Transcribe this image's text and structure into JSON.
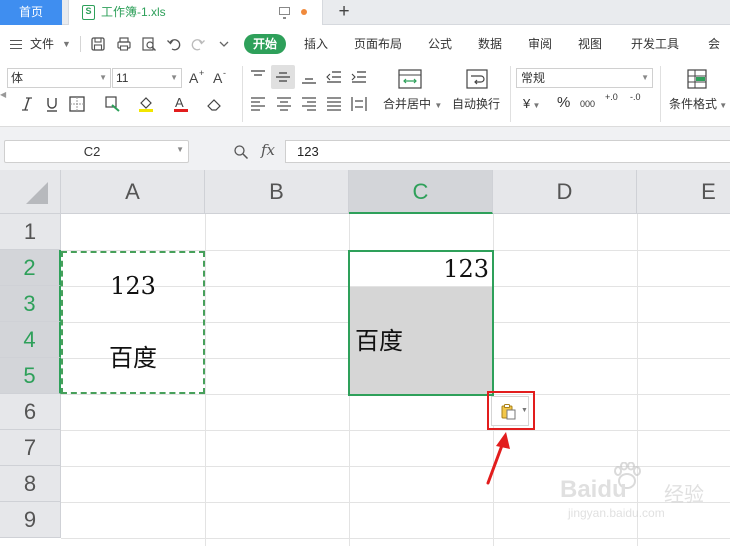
{
  "tabs": {
    "home": "首页",
    "document": "工作簿-1.xls",
    "document_icon": "S",
    "add": "+"
  },
  "menu": {
    "file": "文件",
    "tabs": [
      "开始",
      "插入",
      "页面布局",
      "公式",
      "数据",
      "审阅",
      "视图",
      "开发工具",
      "会员"
    ],
    "active_tab": "开始"
  },
  "toolbar": {
    "font_name": "体",
    "font_size": "11",
    "merge_center": "合并居中",
    "wrap_text": "自动换行",
    "number_format": "常规",
    "currency": "¥",
    "percent": "%",
    "thousands": "000",
    "dec_increase": "+.0",
    "dec_decrease": "-.0",
    "conditional_format": "条件格式"
  },
  "formula_bar": {
    "name_box": "C2",
    "fx": "fx",
    "content": "123"
  },
  "sheet": {
    "columns": [
      "A",
      "B",
      "C",
      "D",
      "E"
    ],
    "selected_column": "C",
    "rows": [
      "1",
      "2",
      "3",
      "4",
      "5",
      "6",
      "7",
      "8",
      "9"
    ],
    "selected_rows": [
      "2",
      "3",
      "4",
      "5"
    ],
    "cells": {
      "A2_3": "123",
      "A4_5": "百度",
      "C2": "123",
      "C4": "百度"
    }
  },
  "colors": {
    "accent": "#2ea05a",
    "tab_home": "#3f8ef0",
    "annotation": "#e21d1d",
    "copy_marquee": "#47a05b"
  },
  "watermark": {
    "brand": "Baidu",
    "brand_cn": "经验",
    "url": "jingyan.baidu.com"
  }
}
